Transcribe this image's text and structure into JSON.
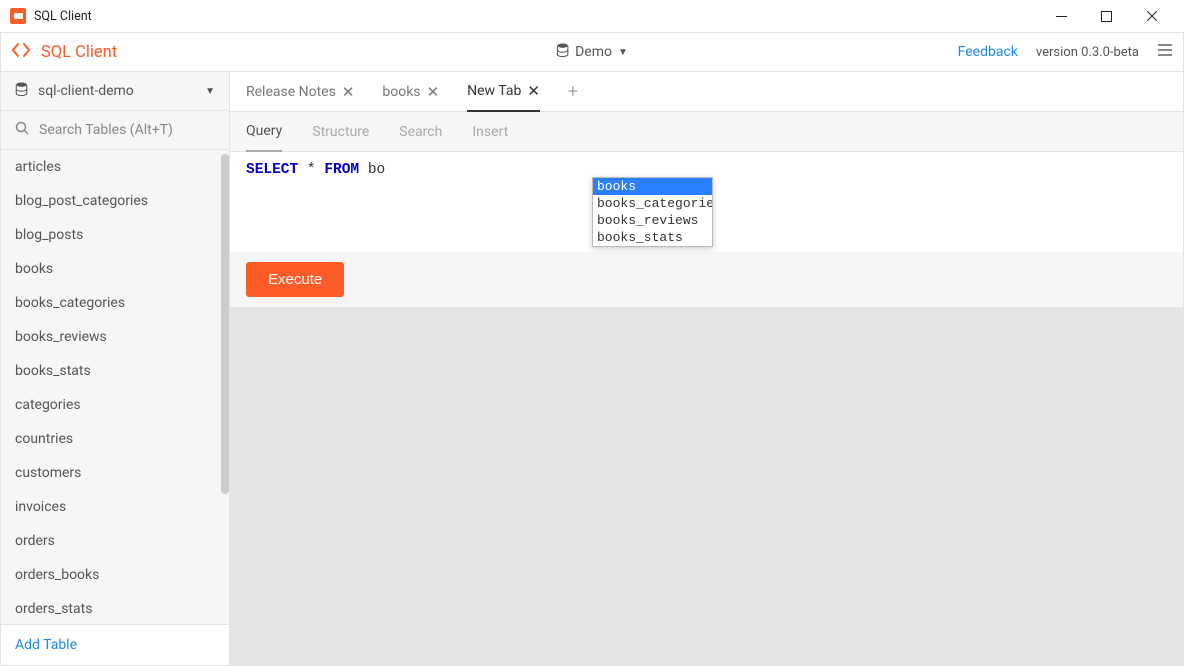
{
  "titlebar": {
    "title": "SQL Client"
  },
  "brand": {
    "name": "SQL Client"
  },
  "centerDb": {
    "label": "Demo"
  },
  "header": {
    "feedback": "Feedback",
    "version": "version 0.3.0-beta"
  },
  "connection": {
    "name": "sql-client-demo"
  },
  "search": {
    "placeholder": "Search Tables (Alt+T)"
  },
  "tables": [
    "articles",
    "blog_post_categories",
    "blog_posts",
    "books",
    "books_categories",
    "books_reviews",
    "books_stats",
    "categories",
    "countries",
    "customers",
    "invoices",
    "orders",
    "orders_books",
    "orders_stats"
  ],
  "addTable": "Add Table",
  "tabs": [
    {
      "label": "Release Notes",
      "active": false
    },
    {
      "label": "books",
      "active": false
    },
    {
      "label": "New Tab",
      "active": true
    }
  ],
  "plus": "+",
  "subtabs": [
    {
      "label": "Query",
      "active": true
    },
    {
      "label": "Structure",
      "active": false
    },
    {
      "label": "Search",
      "active": false
    },
    {
      "label": "Insert",
      "active": false
    }
  ],
  "editor": {
    "select": "SELECT",
    "star": " * ",
    "from": "FROM",
    "typed": " bo"
  },
  "hints": [
    {
      "label": "books",
      "selected": true
    },
    {
      "label": "books_categories",
      "selected": false
    },
    {
      "label": "books_reviews",
      "selected": false
    },
    {
      "label": "books_stats",
      "selected": false
    }
  ],
  "execute": "Execute"
}
